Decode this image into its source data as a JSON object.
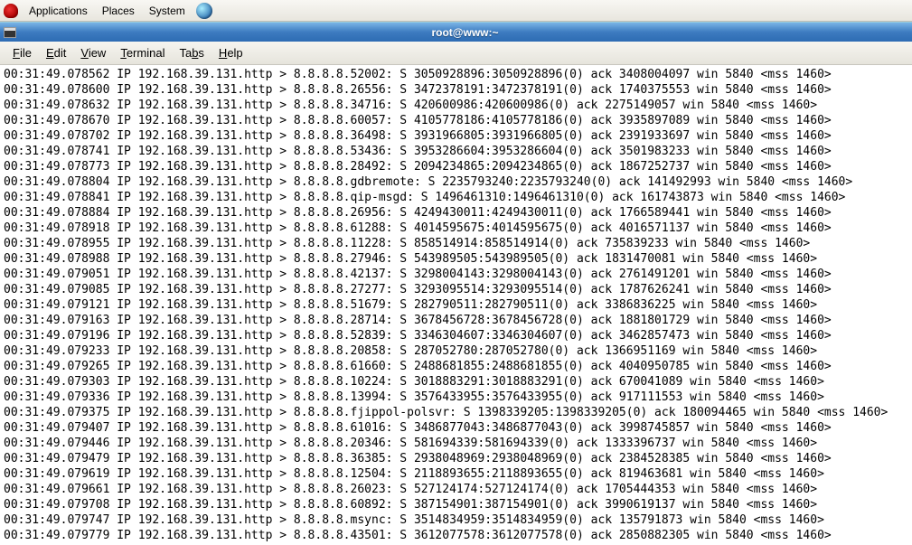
{
  "panel": {
    "applications": "Applications",
    "places": "Places",
    "system": "System"
  },
  "window": {
    "title": "root@www:~"
  },
  "menubar": {
    "file": "File",
    "edit": "Edit",
    "view": "View",
    "terminal": "Terminal",
    "tabs": "Tabs",
    "help": "Help"
  },
  "terminal": {
    "lines": [
      "00:31:49.078562 IP 192.168.39.131.http > 8.8.8.8.52002: S 3050928896:3050928896(0) ack 3408004097 win 5840 <mss 1460>",
      "00:31:49.078600 IP 192.168.39.131.http > 8.8.8.8.26556: S 3472378191:3472378191(0) ack 1740375553 win 5840 <mss 1460>",
      "00:31:49.078632 IP 192.168.39.131.http > 8.8.8.8.34716: S 420600986:420600986(0) ack 2275149057 win 5840 <mss 1460>",
      "00:31:49.078670 IP 192.168.39.131.http > 8.8.8.8.60057: S 4105778186:4105778186(0) ack 3935897089 win 5840 <mss 1460>",
      "00:31:49.078702 IP 192.168.39.131.http > 8.8.8.8.36498: S 3931966805:3931966805(0) ack 2391933697 win 5840 <mss 1460>",
      "00:31:49.078741 IP 192.168.39.131.http > 8.8.8.8.53436: S 3953286604:3953286604(0) ack 3501983233 win 5840 <mss 1460>",
      "00:31:49.078773 IP 192.168.39.131.http > 8.8.8.8.28492: S 2094234865:2094234865(0) ack 1867252737 win 5840 <mss 1460>",
      "00:31:49.078804 IP 192.168.39.131.http > 8.8.8.8.gdbremote: S 2235793240:2235793240(0) ack 141492993 win 5840 <mss 1460>",
      "00:31:49.078841 IP 192.168.39.131.http > 8.8.8.8.qip-msgd: S 1496461310:1496461310(0) ack 161743873 win 5840 <mss 1460>",
      "00:31:49.078884 IP 192.168.39.131.http > 8.8.8.8.26956: S 4249430011:4249430011(0) ack 1766589441 win 5840 <mss 1460>",
      "00:31:49.078918 IP 192.168.39.131.http > 8.8.8.8.61288: S 4014595675:4014595675(0) ack 4016571137 win 5840 <mss 1460>",
      "00:31:49.078955 IP 192.168.39.131.http > 8.8.8.8.11228: S 858514914:858514914(0) ack 735839233 win 5840 <mss 1460>",
      "00:31:49.078988 IP 192.168.39.131.http > 8.8.8.8.27946: S 543989505:543989505(0) ack 1831470081 win 5840 <mss 1460>",
      "00:31:49.079051 IP 192.168.39.131.http > 8.8.8.8.42137: S 3298004143:3298004143(0) ack 2761491201 win 5840 <mss 1460>",
      "00:31:49.079085 IP 192.168.39.131.http > 8.8.8.8.27277: S 3293095514:3293095514(0) ack 1787626241 win 5840 <mss 1460>",
      "00:31:49.079121 IP 192.168.39.131.http > 8.8.8.8.51679: S 282790511:282790511(0) ack 3386836225 win 5840 <mss 1460>",
      "00:31:49.079163 IP 192.168.39.131.http > 8.8.8.8.28714: S 3678456728:3678456728(0) ack 1881801729 win 5840 <mss 1460>",
      "00:31:49.079196 IP 192.168.39.131.http > 8.8.8.8.52839: S 3346304607:3346304607(0) ack 3462857473 win 5840 <mss 1460>",
      "00:31:49.079233 IP 192.168.39.131.http > 8.8.8.8.20858: S 287052780:287052780(0) ack 1366951169 win 5840 <mss 1460>",
      "00:31:49.079265 IP 192.168.39.131.http > 8.8.8.8.61660: S 2488681855:2488681855(0) ack 4040950785 win 5840 <mss 1460>",
      "00:31:49.079303 IP 192.168.39.131.http > 8.8.8.8.10224: S 3018883291:3018883291(0) ack 670041089 win 5840 <mss 1460>",
      "00:31:49.079336 IP 192.168.39.131.http > 8.8.8.8.13994: S 3576433955:3576433955(0) ack 917111553 win 5840 <mss 1460>",
      "00:31:49.079375 IP 192.168.39.131.http > 8.8.8.8.fjippol-polsvr: S 1398339205:1398339205(0) ack 180094465 win 5840 <mss 1460>",
      "00:31:49.079407 IP 192.168.39.131.http > 8.8.8.8.61016: S 3486877043:3486877043(0) ack 3998745857 win 5840 <mss 1460>",
      "00:31:49.079446 IP 192.168.39.131.http > 8.8.8.8.20346: S 581694339:581694339(0) ack 1333396737 win 5840 <mss 1460>",
      "00:31:49.079479 IP 192.168.39.131.http > 8.8.8.8.36385: S 2938048969:2938048969(0) ack 2384528385 win 5840 <mss 1460>",
      "00:31:49.079619 IP 192.168.39.131.http > 8.8.8.8.12504: S 2118893655:2118893655(0) ack 819463681 win 5840 <mss 1460>",
      "00:31:49.079661 IP 192.168.39.131.http > 8.8.8.8.26023: S 527124174:527124174(0) ack 1705444353 win 5840 <mss 1460>",
      "00:31:49.079708 IP 192.168.39.131.http > 8.8.8.8.60892: S 387154901:387154901(0) ack 3990619137 win 5840 <mss 1460>",
      "00:31:49.079747 IP 192.168.39.131.http > 8.8.8.8.msync: S 3514834959:3514834959(0) ack 135791873 win 5840 <mss 1460>",
      "00:31:49.079779 IP 192.168.39.131.http > 8.8.8.8.43501: S 3612077578:3612077578(0) ack 2850882305 win 5840 <mss 1460>"
    ]
  }
}
